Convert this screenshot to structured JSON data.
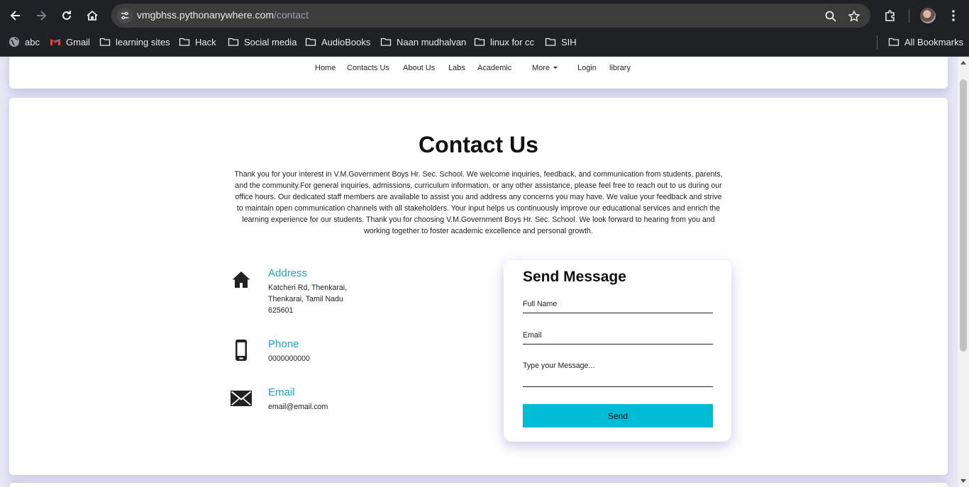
{
  "browser": {
    "url_host": "vmgbhss.pythonanywhere.com",
    "url_path": "/contact",
    "bookmarks": [
      {
        "label": "abc",
        "icon": "globe-icon"
      },
      {
        "label": "Gmail",
        "icon": "gmail-icon"
      },
      {
        "label": "learning sites",
        "icon": "folder-icon"
      },
      {
        "label": "Hack",
        "icon": "folder-icon"
      },
      {
        "label": "Social media",
        "icon": "folder-icon"
      },
      {
        "label": "AudioBooks",
        "icon": "folder-icon"
      },
      {
        "label": "Naan mudhalvan",
        "icon": "folder-icon"
      },
      {
        "label": "linux for cc",
        "icon": "folder-icon"
      },
      {
        "label": "SIH",
        "icon": "folder-icon"
      }
    ],
    "all_bookmarks": "All Bookmarks"
  },
  "nav": {
    "items": [
      "Home",
      "Contacts Us",
      "About Us",
      "Labs",
      "Academic",
      "More",
      "Login",
      "library"
    ]
  },
  "contact": {
    "title": "Contact Us",
    "intro": "Thank you for your interest in V.M.Government Boys Hr. Sec. School. We welcome inquiries, feedback, and communication from students, parents, and the community.For general inquiries, admissions, curriculum information, or any other assistance, please feel free to reach out to us during our office hours. Our dedicated staff members are available to assist you and address any concerns you may have. We value your feedback and strive to maintain open communication channels with all stakeholders. Your input helps us continuously improve our educational services and enrich the learning experience for our students. Thank you for choosing V.M.Government Boys Hr. Sec. School. We look forward to hearing from you and working together to foster academic excellence and personal growth.",
    "address": {
      "title": "Address",
      "line1": "Katcheri Rd, Thenkarai,",
      "line2": "Thenkarai, Tamil Nadu",
      "line3": "625601"
    },
    "phone": {
      "title": "Phone",
      "value": "0000000000"
    },
    "email": {
      "title": "Email",
      "value": "email@email.com"
    }
  },
  "form": {
    "title": "Send Message",
    "full_name_placeholder": "Full Name",
    "email_placeholder": "Email",
    "message_placeholder": "Type your Message...",
    "send_label": "Send"
  },
  "colors": {
    "accent": "#1aa7bf",
    "send_button": "#00bcd4",
    "page_background": "#e8e8f4"
  }
}
